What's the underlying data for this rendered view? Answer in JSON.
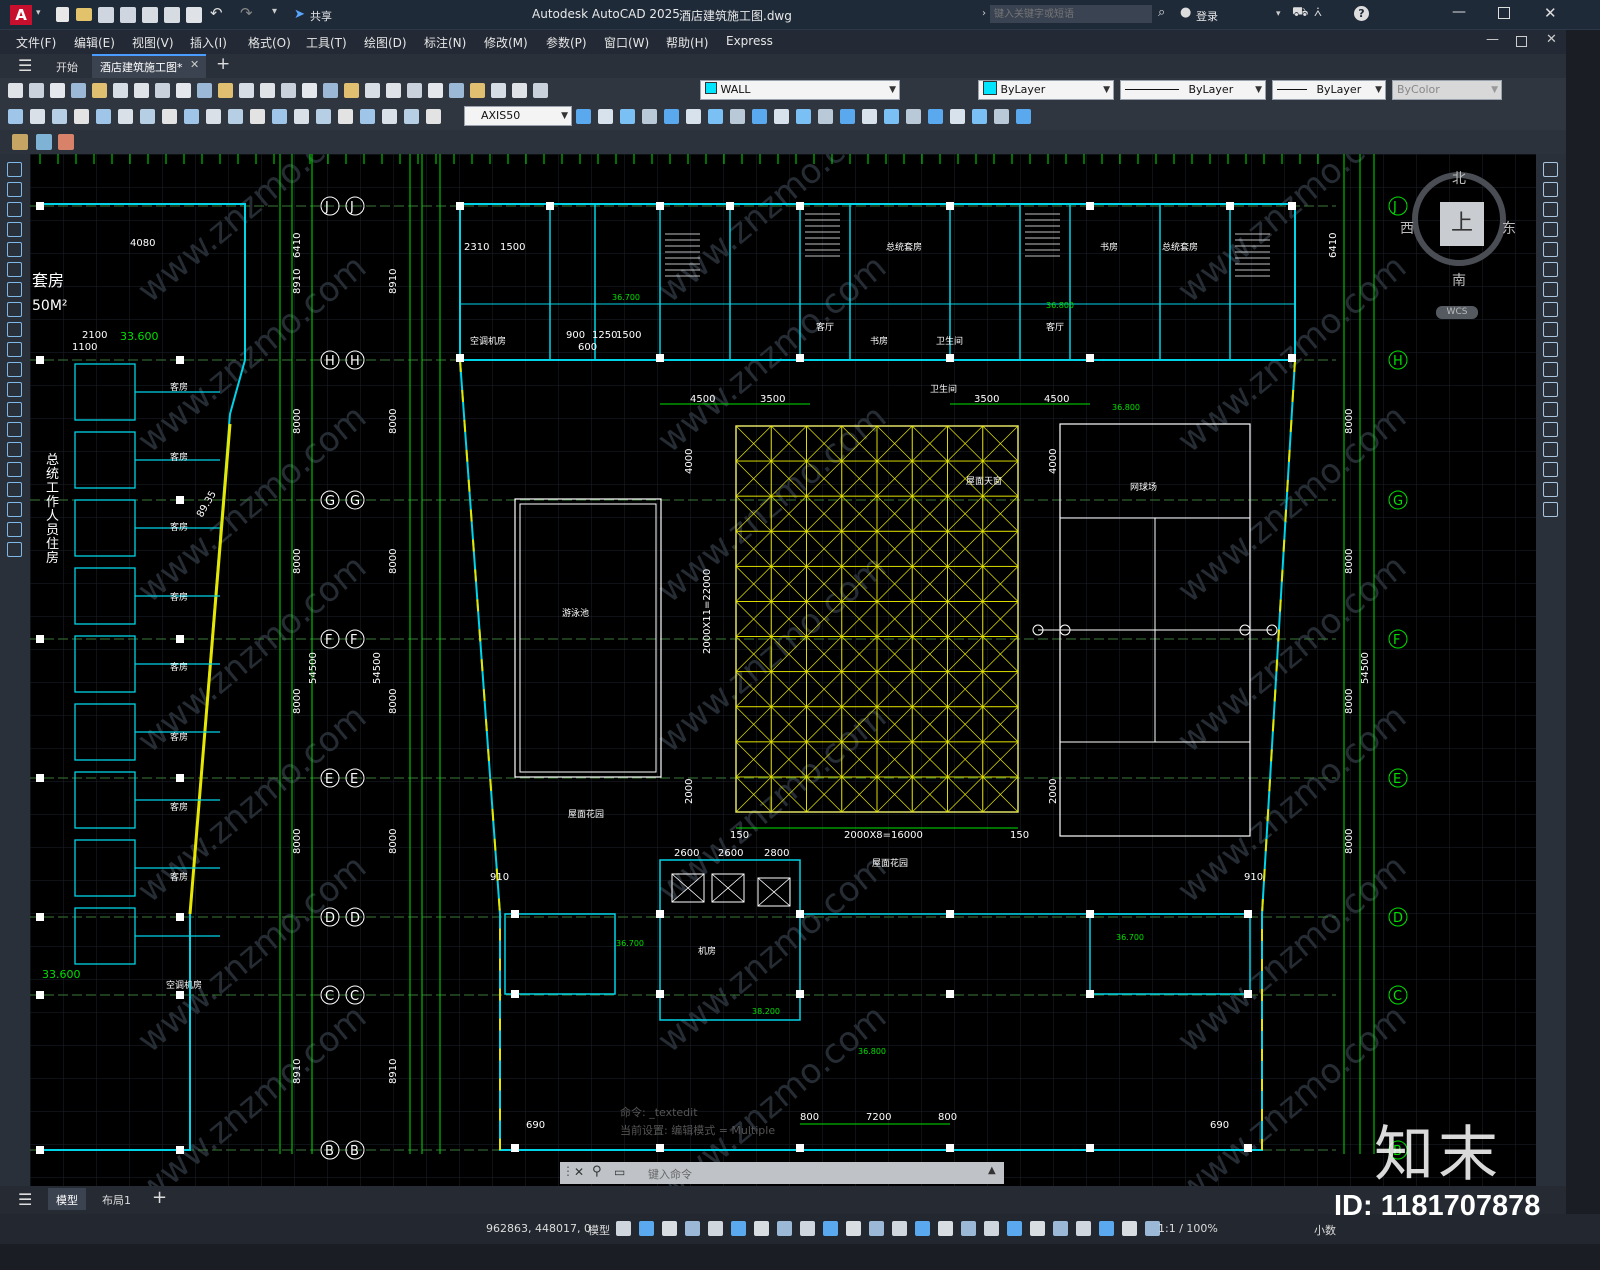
{
  "titlebar": {
    "app_title": "Autodesk AutoCAD 2025",
    "file_title": "酒店建筑施工图.dwg",
    "share_label": "共享",
    "search_placeholder": "键入关键字或短语",
    "login_label": "登录"
  },
  "menu": [
    "文件(F)",
    "编辑(E)",
    "视图(V)",
    "插入(I)",
    "格式(O)",
    "工具(T)",
    "绘图(D)",
    "标注(N)",
    "修改(M)",
    "参数(P)",
    "窗口(W)",
    "帮助(H)",
    "Express"
  ],
  "tabs": {
    "start": "开始",
    "drawing": "酒店建筑施工图*"
  },
  "properties": {
    "layer": "WALL",
    "color": "ByLayer",
    "linetype": "ByLayer",
    "lineweight": "ByLayer",
    "plotstyle": "ByColor",
    "dimstyle": "AXIS50"
  },
  "viewcube": {
    "north": "北",
    "south": "南",
    "east": "东",
    "west": "西",
    "face": "上",
    "wcs": "WCS"
  },
  "command": {
    "history": [
      "命令: _textedit",
      "当前设置: 编辑模式 = Multiple"
    ],
    "placeholder": "键入命令"
  },
  "layout_tabs": [
    "模型",
    "布局1"
  ],
  "status": {
    "coords": "962863, 448017, 0",
    "mode": "模型",
    "scale": "1:1 / 100%",
    "units": "小数"
  },
  "watermark": {
    "logo": "知末",
    "id": "ID: 1181707878",
    "site": "www.znzmo.com"
  },
  "drawing": {
    "axes_left": [
      "J",
      "H",
      "G",
      "F",
      "E",
      "D",
      "C",
      "B"
    ],
    "axes_right": [
      "J",
      "H",
      "G",
      "F",
      "E",
      "D",
      "C",
      "B"
    ],
    "rooms": {
      "pool": "游泳池",
      "skylight": "屋面天窗",
      "tennis": "网球场",
      "roof_garden_1": "屋面花园",
      "roof_garden_2": "屋面花园",
      "machine_room": "机房",
      "suite": "总统套房",
      "guest_room": "客房",
      "bathroom": "卫生间",
      "living": "客厅",
      "study": "书房",
      "staff_residence": "总统工作人员住房",
      "ac_room": "空调机房",
      "stair": "楼梯间"
    },
    "dims_top": [
      "4500",
      "3500",
      "3500",
      "4500",
      "36.800"
    ],
    "dims_bottom": [
      "2600",
      "2600",
      "2800",
      "150",
      "2000X8=16000",
      "150"
    ],
    "dims_bottom_edge": [
      "690",
      "800",
      "7200",
      "800",
      "690"
    ],
    "dim_vert": [
      "2000X11=22000",
      "4000",
      "2000",
      "54500",
      "8000",
      "8910",
      "6410"
    ],
    "elevations": [
      "36.700",
      "36.800",
      "38.200",
      "33.600"
    ],
    "misc_dims": [
      "910",
      "2310",
      "1500",
      "4080",
      "2100",
      "1100",
      "600",
      "900",
      "1250",
      "1500",
      "89.35"
    ],
    "top_room_left": "50M²",
    "top_room_label": "套房"
  }
}
